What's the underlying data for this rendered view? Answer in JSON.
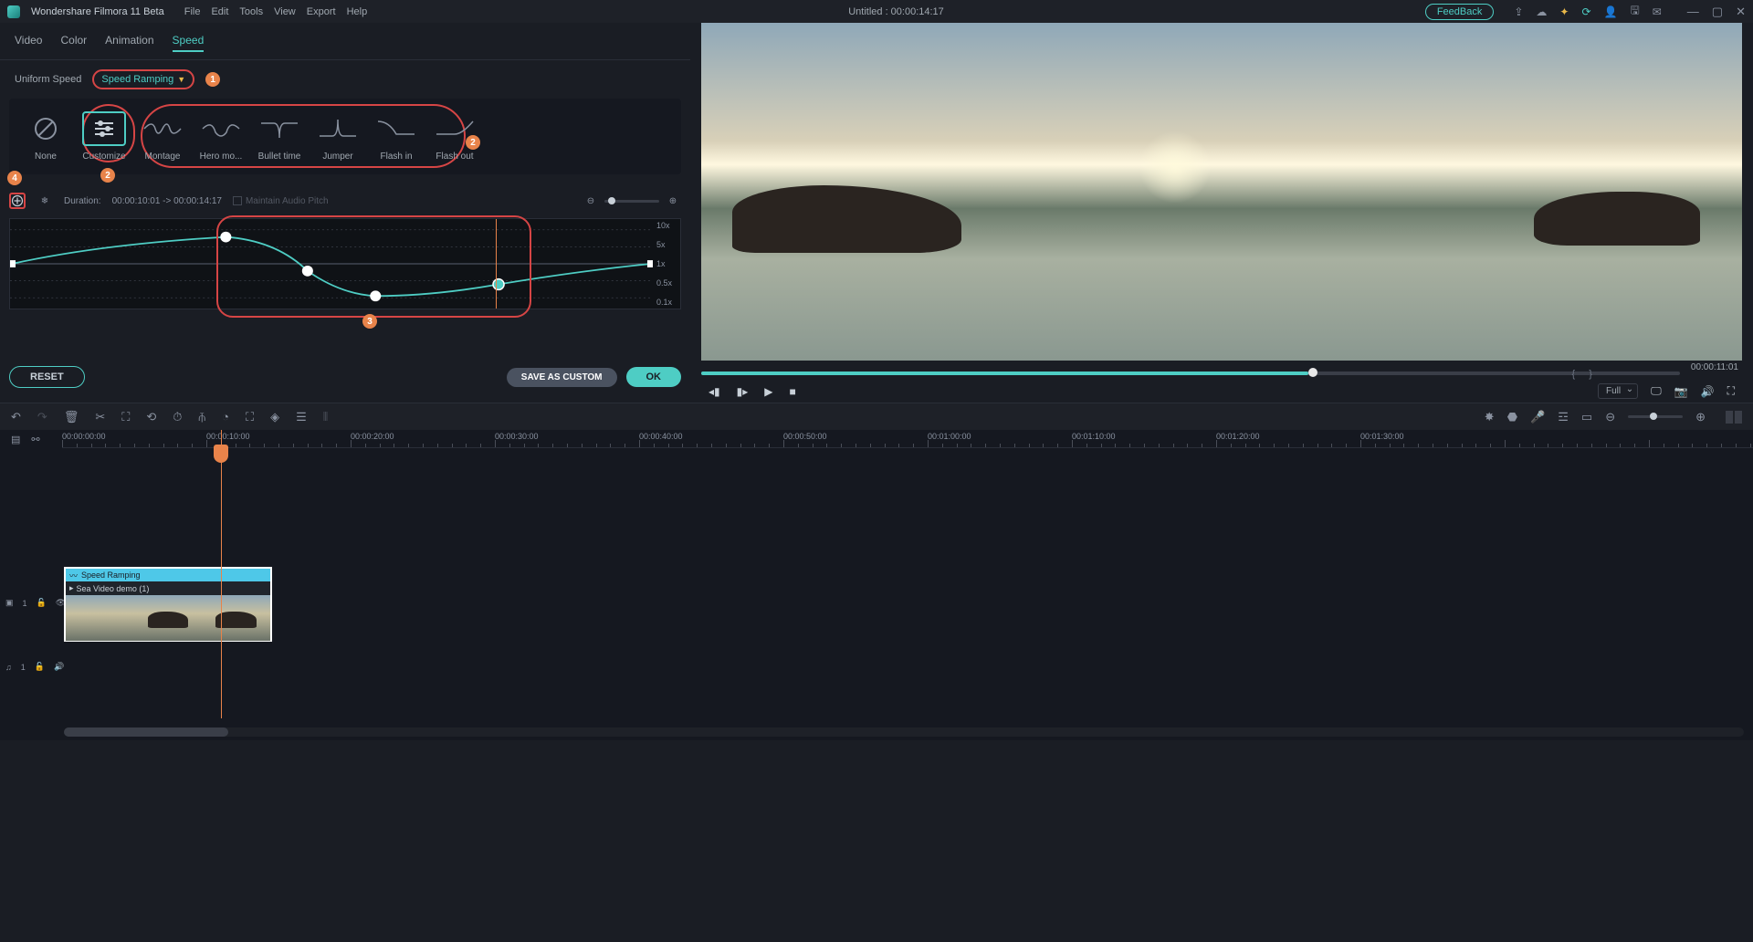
{
  "app": {
    "title": "Wondershare Filmora 11 Beta"
  },
  "menu": {
    "file": "File",
    "edit": "Edit",
    "tools": "Tools",
    "view": "View",
    "export": "Export",
    "help": "Help"
  },
  "title_center": "Untitled : 00:00:14:17",
  "feedback": "FeedBack",
  "tabs": {
    "video": "Video",
    "color": "Color",
    "animation": "Animation",
    "speed": "Speed"
  },
  "subtabs": {
    "uniform": "Uniform Speed",
    "ramping": "Speed Ramping"
  },
  "badges": {
    "b1": "1",
    "b2a": "2",
    "b2b": "2",
    "b3": "3",
    "b4": "4"
  },
  "presets": {
    "none": "None",
    "customize": "Customize",
    "montage": "Montage",
    "hero": "Hero mo...",
    "bullet": "Bullet time",
    "jumper": "Jumper",
    "flashin": "Flash in",
    "flashout": "Flash out"
  },
  "controls": {
    "duration_label": "Duration:",
    "duration_value": "00:00:10:01 -> 00:00:14:17",
    "maintain_pitch": "Maintain Audio Pitch"
  },
  "speed_labels": {
    "x10": "10x",
    "x5": "5x",
    "x1": "1x",
    "x05": "0.5x",
    "x01": "0.1x"
  },
  "buttons": {
    "reset": "RESET",
    "save_custom": "SAVE AS CUSTOM",
    "ok": "OK"
  },
  "preview": {
    "time": "00:00:11:01",
    "full": "Full"
  },
  "timeline": {
    "times": [
      "00:00:00:00",
      "00:00:10:00",
      "00:00:20:00",
      "00:00:30:00",
      "00:00:40:00",
      "00:00:50:00",
      "00:01:00:00",
      "00:01:10:00",
      "00:01:20:00",
      "00:01:30:00"
    ],
    "clip_header": "Speed Ramping",
    "clip_title": "Sea Video demo (1)",
    "video_track": "1",
    "audio_track": "1",
    "audio_prefix": "♫"
  }
}
